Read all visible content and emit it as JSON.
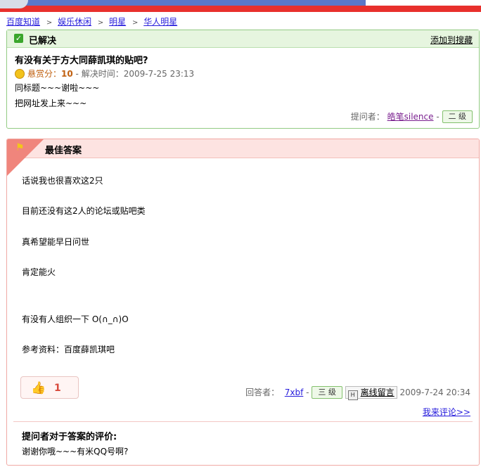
{
  "breadcrumb": {
    "items": [
      "百度知道",
      "娱乐休闲",
      "明星",
      "华人明星"
    ],
    "separator": ">"
  },
  "question": {
    "status": "已解决",
    "add_favorite": "添加到搜藏",
    "title": "有没有关于方大同薛凯琪的贴吧?",
    "reward_label": "悬赏分：",
    "reward_value": "10",
    "solved_time": "- 解决时间：2009-7-25 23:13",
    "body_lines": [
      "同标题~~~谢啦~~~",
      "把网址发上来~~~"
    ],
    "asker_label": "提问者：",
    "asker_name": "皓笔silence",
    "asker_level": "二 级"
  },
  "answer": {
    "header": "最佳答案",
    "lines": [
      "话说我也很喜欢这2只",
      "目前还没有这2人的论坛或贴吧类",
      "真希望能早日问世",
      "肯定能火",
      "有没有人组织一下  O(∩_∩)O",
      "参考资料：百度薛凯琪吧"
    ],
    "like_count": "1",
    "answerer_label": "回答者：",
    "answerer_name": "7xbf",
    "answerer_level": "三 级",
    "message_button": "离线留言",
    "answer_time": "2009-7-24 20:34",
    "comment_link": "我来评论>>"
  },
  "evaluation": {
    "title": "提问者对于答案的评价:",
    "text": "谢谢你哦~~~有米QQ号啊?"
  }
}
